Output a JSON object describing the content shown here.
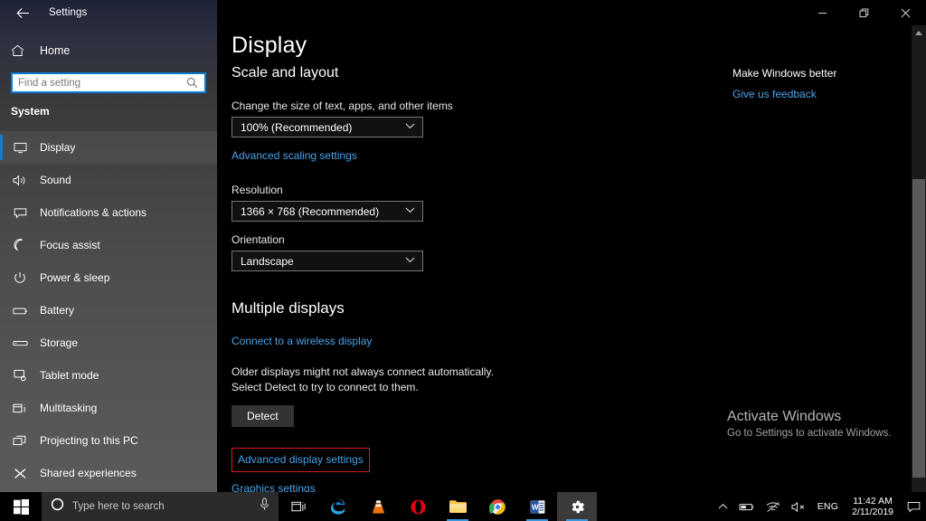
{
  "window": {
    "title": "Settings",
    "back_icon": "back-arrow-icon",
    "minimize_label": "–",
    "restore_label": "❐",
    "close_label": "✕"
  },
  "sidebar": {
    "home_label": "Home",
    "search": {
      "placeholder": "Find a setting",
      "value": "",
      "icon": "search-icon"
    },
    "section_header": "System",
    "items": [
      {
        "label": "Display",
        "icon": "monitor-icon",
        "selected": true
      },
      {
        "label": "Sound",
        "icon": "speaker-icon",
        "selected": false
      },
      {
        "label": "Notifications & actions",
        "icon": "notification-icon",
        "selected": false
      },
      {
        "label": "Focus assist",
        "icon": "moon-icon",
        "selected": false
      },
      {
        "label": "Power & sleep",
        "icon": "power-icon",
        "selected": false
      },
      {
        "label": "Battery",
        "icon": "battery-icon",
        "selected": false
      },
      {
        "label": "Storage",
        "icon": "storage-icon",
        "selected": false
      },
      {
        "label": "Tablet mode",
        "icon": "tablet-icon",
        "selected": false
      },
      {
        "label": "Multitasking",
        "icon": "multitasking-icon",
        "selected": false
      },
      {
        "label": "Projecting to this PC",
        "icon": "project-icon",
        "selected": false
      },
      {
        "label": "Shared experiences",
        "icon": "share-icon",
        "selected": false
      }
    ]
  },
  "main": {
    "page_title": "Display",
    "scale_section": {
      "heading": "Scale and layout",
      "scale_label": "Change the size of text, apps, and other items",
      "scale_value": "100% (Recommended)",
      "advanced_scaling_link": "Advanced scaling settings",
      "resolution_label": "Resolution",
      "resolution_value": "1366 × 768 (Recommended)",
      "orientation_label": "Orientation",
      "orientation_value": "Landscape"
    },
    "multiple_displays": {
      "heading": "Multiple displays",
      "wireless_link": "Connect to a wireless display",
      "description": "Older displays might not always connect automatically. Select Detect to try to connect to them.",
      "detect_button": "Detect",
      "advanced_display_link": "Advanced display settings",
      "graphics_link": "Graphics settings",
      "highlight_color": "#d81b1b"
    },
    "right_rail": {
      "title": "Make Windows better",
      "feedback_link": "Give us feedback"
    },
    "watermark": {
      "title": "Activate Windows",
      "subtitle": "Go to Settings to activate Windows."
    },
    "scrollbar": {
      "up_arrow": "▲"
    }
  },
  "taskbar": {
    "start_icon": "windows-start-icon",
    "search": {
      "placeholder": "Type here to search",
      "icon": "cortana-circle-icon",
      "mic_icon": "microphone-icon"
    },
    "task_view_icon": "task-view-icon",
    "apps": [
      {
        "name": "edge",
        "icon": "edge-icon",
        "running": false
      },
      {
        "name": "vlc",
        "icon": "vlc-cone-icon",
        "running": false
      },
      {
        "name": "opera",
        "icon": "opera-icon",
        "running": false
      },
      {
        "name": "file-explorer",
        "icon": "folder-icon",
        "running": true
      },
      {
        "name": "chrome",
        "icon": "chrome-icon",
        "running": false
      },
      {
        "name": "word",
        "icon": "word-icon",
        "running": true
      },
      {
        "name": "settings",
        "icon": "gear-icon",
        "running": true,
        "active": true
      }
    ],
    "tray": {
      "chevron_icon": "chevron-up-icon",
      "battery_icon": "battery-icon",
      "network_icon": "wifi-icon",
      "volume_icon": "speaker-muted-icon",
      "language": "ENG",
      "time": "11:42 AM",
      "date": "2/11/2019",
      "action_center_icon": "action-center-icon"
    }
  },
  "colors": {
    "accent": "#0c7cd5",
    "link": "#4aa3e8",
    "highlight": "#d81b1b",
    "taskbar_bg": "#000000"
  }
}
